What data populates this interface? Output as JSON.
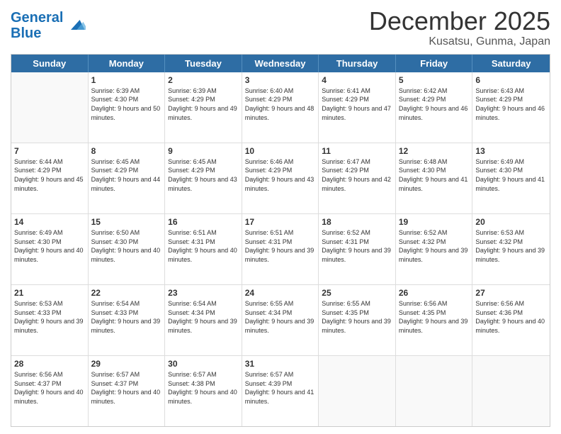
{
  "logo": {
    "line1": "General",
    "line2": "Blue"
  },
  "title": "December 2025",
  "subtitle": "Kusatsu, Gunma, Japan",
  "days": [
    "Sunday",
    "Monday",
    "Tuesday",
    "Wednesday",
    "Thursday",
    "Friday",
    "Saturday"
  ],
  "weeks": [
    [
      {
        "day": "",
        "sunrise": "",
        "sunset": "",
        "daylight": ""
      },
      {
        "day": "1",
        "sunrise": "Sunrise: 6:39 AM",
        "sunset": "Sunset: 4:30 PM",
        "daylight": "Daylight: 9 hours and 50 minutes."
      },
      {
        "day": "2",
        "sunrise": "Sunrise: 6:39 AM",
        "sunset": "Sunset: 4:29 PM",
        "daylight": "Daylight: 9 hours and 49 minutes."
      },
      {
        "day": "3",
        "sunrise": "Sunrise: 6:40 AM",
        "sunset": "Sunset: 4:29 PM",
        "daylight": "Daylight: 9 hours and 48 minutes."
      },
      {
        "day": "4",
        "sunrise": "Sunrise: 6:41 AM",
        "sunset": "Sunset: 4:29 PM",
        "daylight": "Daylight: 9 hours and 47 minutes."
      },
      {
        "day": "5",
        "sunrise": "Sunrise: 6:42 AM",
        "sunset": "Sunset: 4:29 PM",
        "daylight": "Daylight: 9 hours and 46 minutes."
      },
      {
        "day": "6",
        "sunrise": "Sunrise: 6:43 AM",
        "sunset": "Sunset: 4:29 PM",
        "daylight": "Daylight: 9 hours and 46 minutes."
      }
    ],
    [
      {
        "day": "7",
        "sunrise": "Sunrise: 6:44 AM",
        "sunset": "Sunset: 4:29 PM",
        "daylight": "Daylight: 9 hours and 45 minutes."
      },
      {
        "day": "8",
        "sunrise": "Sunrise: 6:45 AM",
        "sunset": "Sunset: 4:29 PM",
        "daylight": "Daylight: 9 hours and 44 minutes."
      },
      {
        "day": "9",
        "sunrise": "Sunrise: 6:45 AM",
        "sunset": "Sunset: 4:29 PM",
        "daylight": "Daylight: 9 hours and 43 minutes."
      },
      {
        "day": "10",
        "sunrise": "Sunrise: 6:46 AM",
        "sunset": "Sunset: 4:29 PM",
        "daylight": "Daylight: 9 hours and 43 minutes."
      },
      {
        "day": "11",
        "sunrise": "Sunrise: 6:47 AM",
        "sunset": "Sunset: 4:29 PM",
        "daylight": "Daylight: 9 hours and 42 minutes."
      },
      {
        "day": "12",
        "sunrise": "Sunrise: 6:48 AM",
        "sunset": "Sunset: 4:30 PM",
        "daylight": "Daylight: 9 hours and 41 minutes."
      },
      {
        "day": "13",
        "sunrise": "Sunrise: 6:49 AM",
        "sunset": "Sunset: 4:30 PM",
        "daylight": "Daylight: 9 hours and 41 minutes."
      }
    ],
    [
      {
        "day": "14",
        "sunrise": "Sunrise: 6:49 AM",
        "sunset": "Sunset: 4:30 PM",
        "daylight": "Daylight: 9 hours and 40 minutes."
      },
      {
        "day": "15",
        "sunrise": "Sunrise: 6:50 AM",
        "sunset": "Sunset: 4:30 PM",
        "daylight": "Daylight: 9 hours and 40 minutes."
      },
      {
        "day": "16",
        "sunrise": "Sunrise: 6:51 AM",
        "sunset": "Sunset: 4:31 PM",
        "daylight": "Daylight: 9 hours and 40 minutes."
      },
      {
        "day": "17",
        "sunrise": "Sunrise: 6:51 AM",
        "sunset": "Sunset: 4:31 PM",
        "daylight": "Daylight: 9 hours and 39 minutes."
      },
      {
        "day": "18",
        "sunrise": "Sunrise: 6:52 AM",
        "sunset": "Sunset: 4:31 PM",
        "daylight": "Daylight: 9 hours and 39 minutes."
      },
      {
        "day": "19",
        "sunrise": "Sunrise: 6:52 AM",
        "sunset": "Sunset: 4:32 PM",
        "daylight": "Daylight: 9 hours and 39 minutes."
      },
      {
        "day": "20",
        "sunrise": "Sunrise: 6:53 AM",
        "sunset": "Sunset: 4:32 PM",
        "daylight": "Daylight: 9 hours and 39 minutes."
      }
    ],
    [
      {
        "day": "21",
        "sunrise": "Sunrise: 6:53 AM",
        "sunset": "Sunset: 4:33 PM",
        "daylight": "Daylight: 9 hours and 39 minutes."
      },
      {
        "day": "22",
        "sunrise": "Sunrise: 6:54 AM",
        "sunset": "Sunset: 4:33 PM",
        "daylight": "Daylight: 9 hours and 39 minutes."
      },
      {
        "day": "23",
        "sunrise": "Sunrise: 6:54 AM",
        "sunset": "Sunset: 4:34 PM",
        "daylight": "Daylight: 9 hours and 39 minutes."
      },
      {
        "day": "24",
        "sunrise": "Sunrise: 6:55 AM",
        "sunset": "Sunset: 4:34 PM",
        "daylight": "Daylight: 9 hours and 39 minutes."
      },
      {
        "day": "25",
        "sunrise": "Sunrise: 6:55 AM",
        "sunset": "Sunset: 4:35 PM",
        "daylight": "Daylight: 9 hours and 39 minutes."
      },
      {
        "day": "26",
        "sunrise": "Sunrise: 6:56 AM",
        "sunset": "Sunset: 4:35 PM",
        "daylight": "Daylight: 9 hours and 39 minutes."
      },
      {
        "day": "27",
        "sunrise": "Sunrise: 6:56 AM",
        "sunset": "Sunset: 4:36 PM",
        "daylight": "Daylight: 9 hours and 40 minutes."
      }
    ],
    [
      {
        "day": "28",
        "sunrise": "Sunrise: 6:56 AM",
        "sunset": "Sunset: 4:37 PM",
        "daylight": "Daylight: 9 hours and 40 minutes."
      },
      {
        "day": "29",
        "sunrise": "Sunrise: 6:57 AM",
        "sunset": "Sunset: 4:37 PM",
        "daylight": "Daylight: 9 hours and 40 minutes."
      },
      {
        "day": "30",
        "sunrise": "Sunrise: 6:57 AM",
        "sunset": "Sunset: 4:38 PM",
        "daylight": "Daylight: 9 hours and 40 minutes."
      },
      {
        "day": "31",
        "sunrise": "Sunrise: 6:57 AM",
        "sunset": "Sunset: 4:39 PM",
        "daylight": "Daylight: 9 hours and 41 minutes."
      },
      {
        "day": "",
        "sunrise": "",
        "sunset": "",
        "daylight": ""
      },
      {
        "day": "",
        "sunrise": "",
        "sunset": "",
        "daylight": ""
      },
      {
        "day": "",
        "sunrise": "",
        "sunset": "",
        "daylight": ""
      }
    ]
  ]
}
